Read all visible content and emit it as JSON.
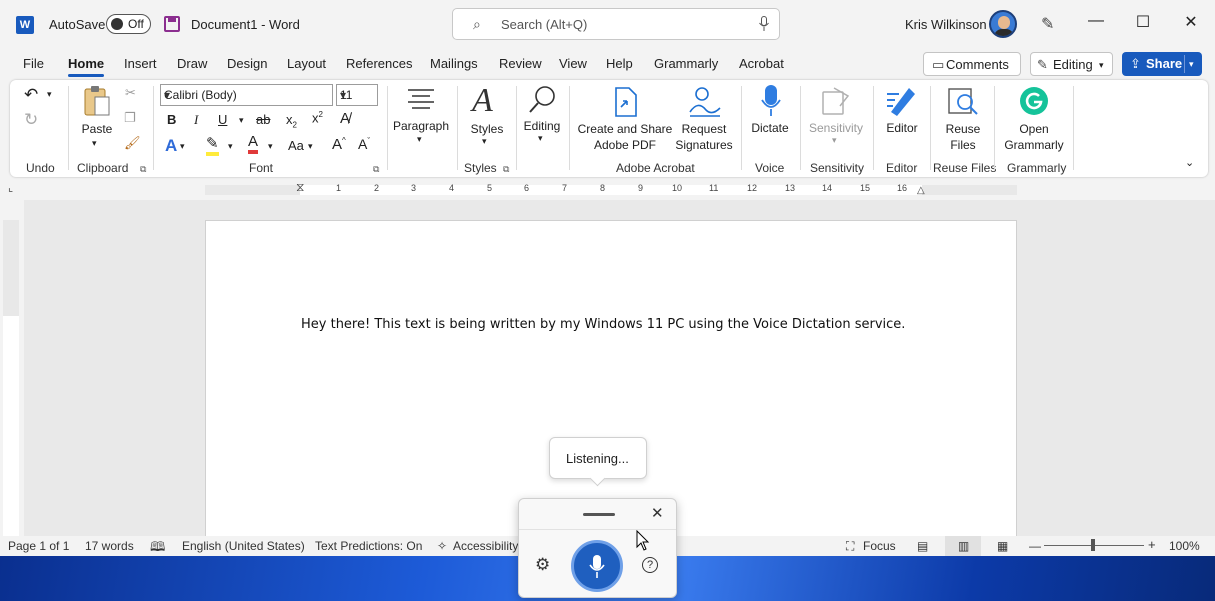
{
  "titlebar": {
    "autosave_label": "AutoSave",
    "autosave_state": "Off",
    "doc_title": "Document1  -  Word",
    "search_placeholder": "Search (Alt+Q)",
    "user_name": "Kris Wilkinson"
  },
  "tabs": [
    "File",
    "Home",
    "Insert",
    "Draw",
    "Design",
    "Layout",
    "References",
    "Mailings",
    "Review",
    "View",
    "Help",
    "Grammarly",
    "Acrobat"
  ],
  "active_tab": "Home",
  "actions": {
    "comments": "Comments",
    "editing": "Editing",
    "share": "Share"
  },
  "ribbon": {
    "undo_group": "Undo",
    "paste": "Paste",
    "clipboard_group": "Clipboard",
    "font_name": "Calibri (Body)",
    "font_size": "11",
    "font_group": "Font",
    "paragraph": "Paragraph",
    "styles": "Styles",
    "styles_group": "Styles",
    "editing": "Editing",
    "create_share_pdf": [
      "Create and Share",
      "Adobe PDF"
    ],
    "request_signatures": [
      "Request",
      "Signatures"
    ],
    "adobe_group": "Adobe Acrobat",
    "dictate": "Dictate",
    "voice_group": "Voice",
    "sensitivity": "Sensitivity",
    "sensitivity_group": "Sensitivity",
    "editor": "Editor",
    "editor_group": "Editor",
    "reuse_files": [
      "Reuse",
      "Files"
    ],
    "reuse_group": "Reuse Files",
    "open_grammarly": [
      "Open",
      "Grammarly"
    ],
    "grammarly_group": "Grammarly"
  },
  "ruler_numbers": [
    "1",
    "2",
    "3",
    "4",
    "5",
    "6",
    "7",
    "8",
    "9",
    "10",
    "11",
    "12",
    "13",
    "14",
    "15",
    "16"
  ],
  "document": {
    "text": "Hey there! This text is being written by my Windows 11 PC using the Voice Dictation service."
  },
  "voice_popup": {
    "status": "Listening..."
  },
  "statusbar": {
    "page": "Page 1 of 1",
    "words": "17 words",
    "language": "English (United States)",
    "predictions": "Text Predictions: On",
    "accessibility": "Accessibility:",
    "focus": "Focus",
    "zoom": "100%"
  },
  "colors": {
    "accent": "#185abd",
    "font_color_red": "#e03a3a",
    "highlight_yellow": "#ffeb3b",
    "grammarly_green": "#15c39a"
  }
}
